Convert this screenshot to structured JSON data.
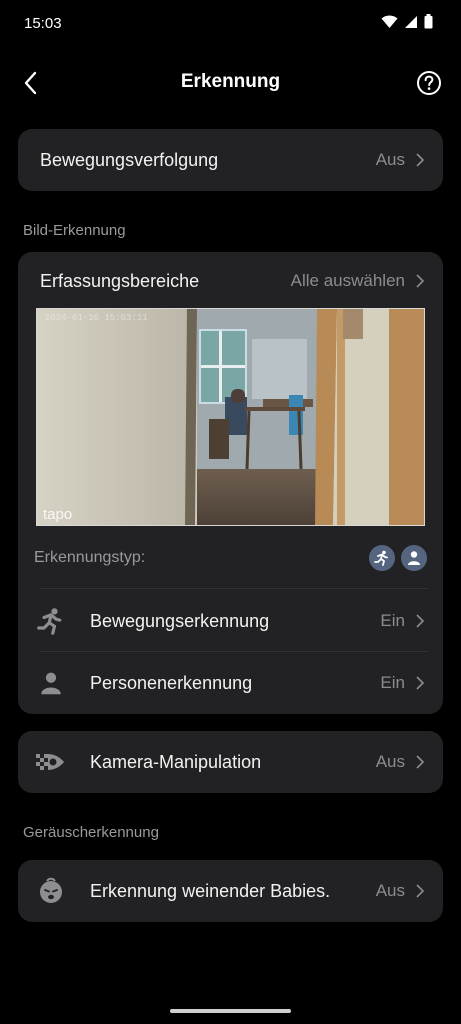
{
  "status_bar": {
    "time": "15:03"
  },
  "header": {
    "title": "Erkennung"
  },
  "motion_tracking": {
    "label": "Bewegungsverfolgung",
    "value": "Aus"
  },
  "image_detection": {
    "section_label": "Bild-Erkennung",
    "areas": {
      "label": "Erfassungsbereiche",
      "value": "Alle auswählen"
    },
    "camera_watermark": "tapo",
    "detection_type_label": "Erkennungstyp:",
    "motion": {
      "label": "Bewegungserkennung",
      "value": "Ein"
    },
    "person": {
      "label": "Personenerkennung",
      "value": "Ein"
    },
    "accent_color": "#56657f"
  },
  "tamper": {
    "label": "Kamera-Manipulation",
    "value": "Aus"
  },
  "sound_detection": {
    "section_label": "Geräuscherkennung",
    "baby_cry": {
      "label": "Erkennung weinender Babies.",
      "value": "Aus"
    }
  }
}
